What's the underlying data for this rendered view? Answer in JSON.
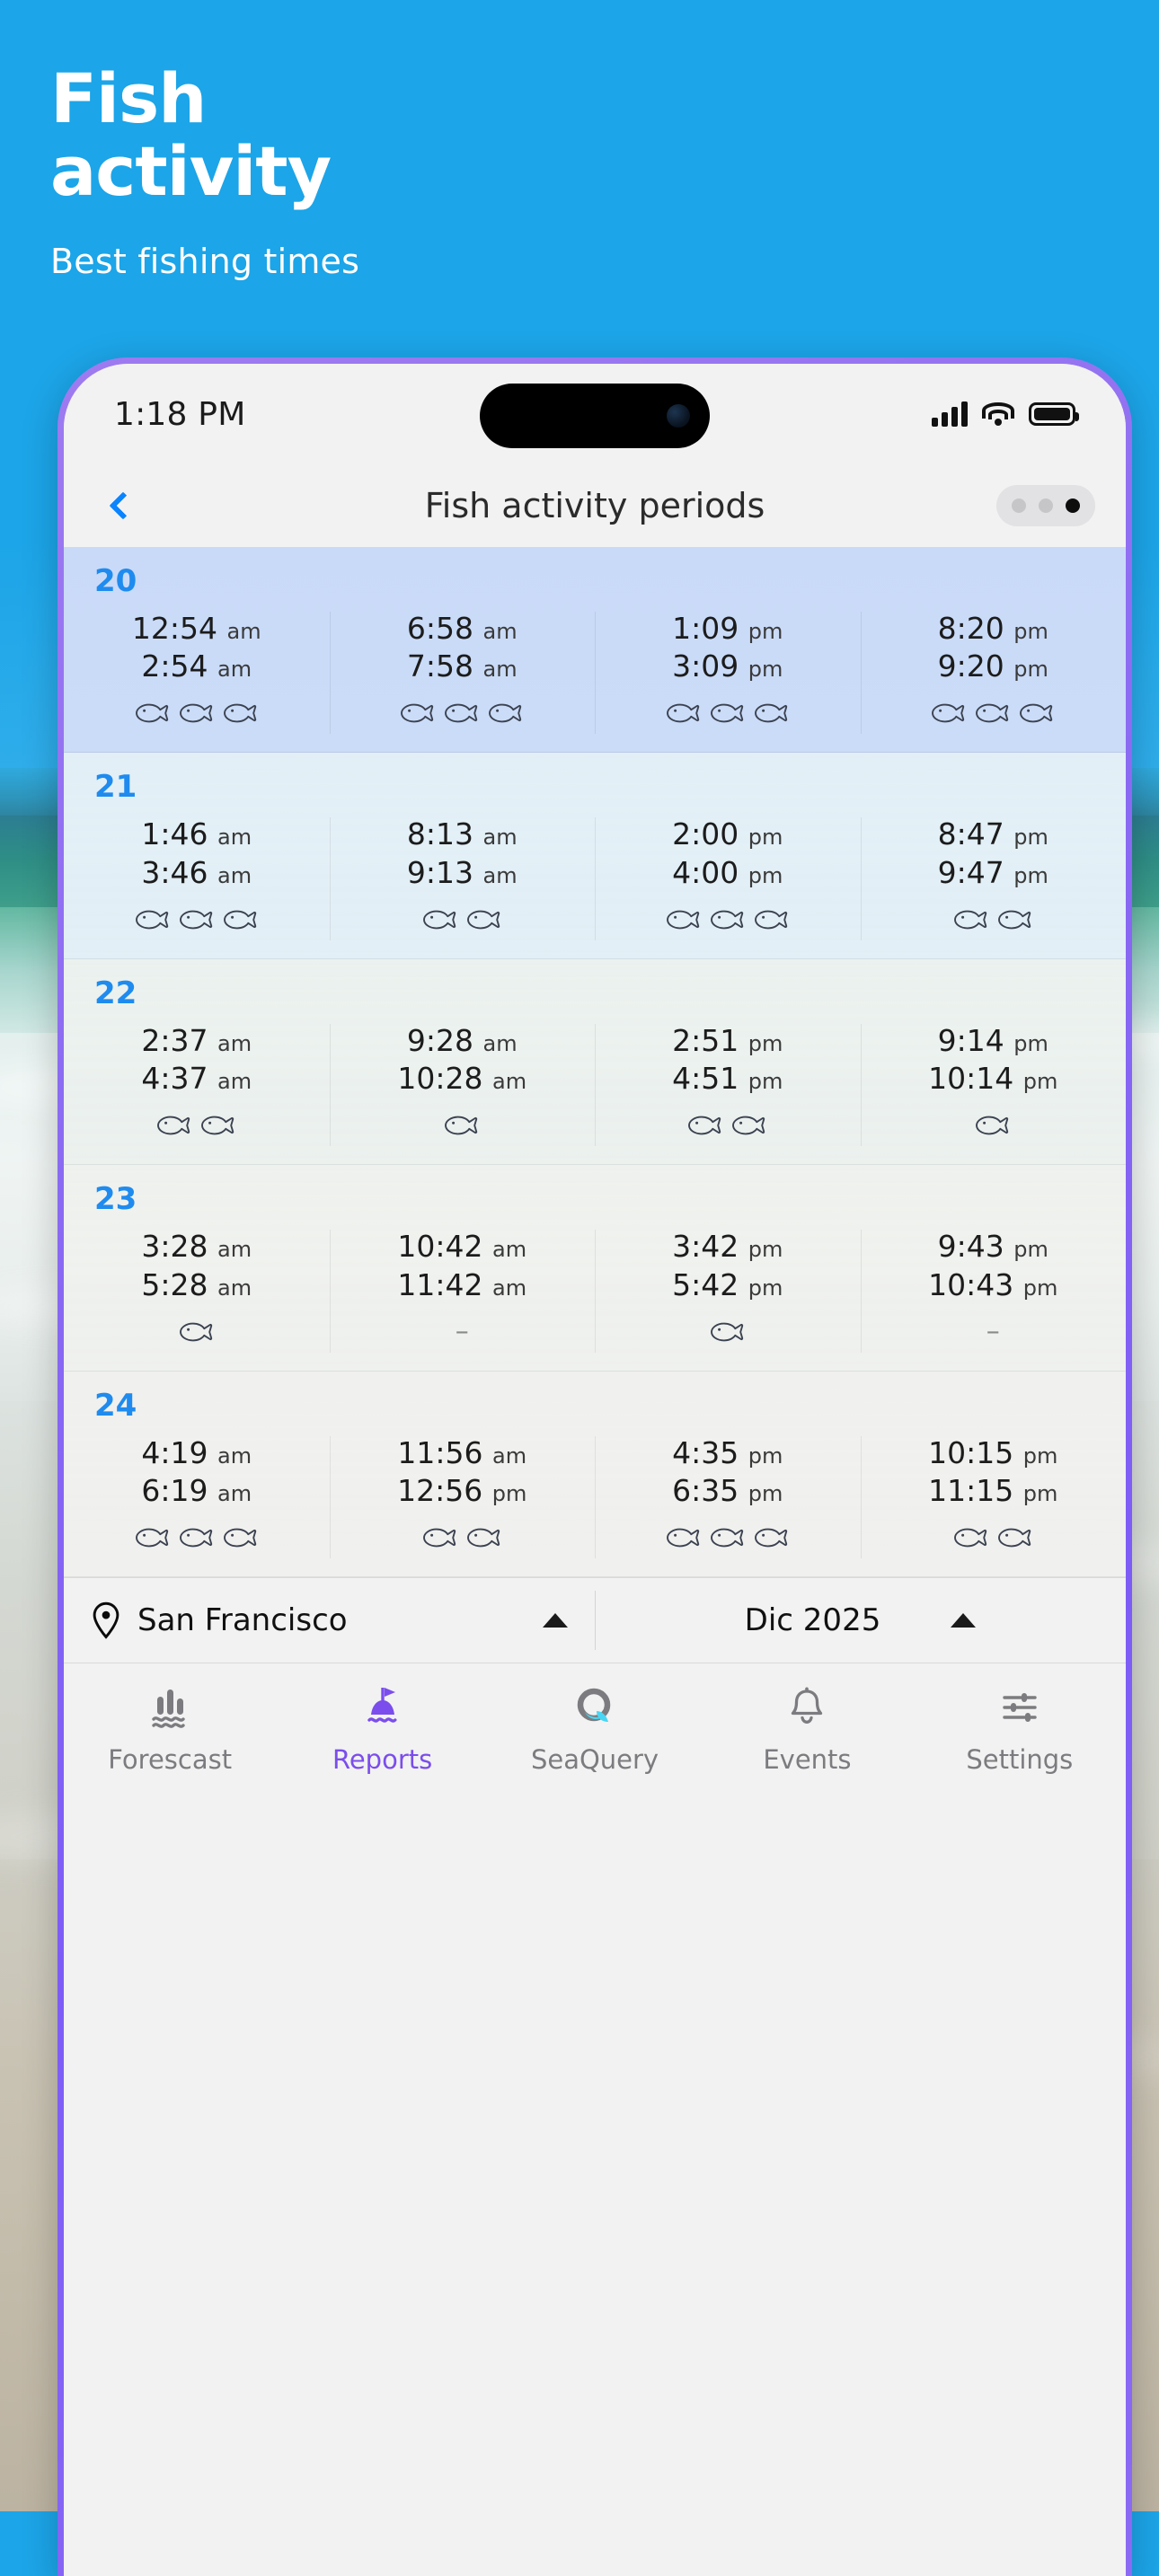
{
  "hero": {
    "title": "Fish\nactivity",
    "subtitle": "Best fishing times"
  },
  "colors": {
    "brand_blue": "#1CA5E8",
    "accent_purple": "#7B4DEC",
    "link_blue": "#0A84FF",
    "day_number_blue": "#1F8BEF"
  },
  "status_bar": {
    "time": "1:18 PM",
    "signal_icon": "cellular-signal-icon",
    "wifi_icon": "wifi-icon",
    "battery_icon": "battery-full-icon"
  },
  "nav": {
    "back_icon": "chevron-left-icon",
    "title": "Fish activity periods",
    "dots": [
      "inactive",
      "inactive",
      "active"
    ]
  },
  "days": [
    {
      "day": "20",
      "highlight": true,
      "periods": [
        {
          "start": "12:54",
          "start_mer": "am",
          "end": "2:54",
          "end_mer": "am",
          "fish": 3
        },
        {
          "start": "6:58",
          "start_mer": "am",
          "end": "7:58",
          "end_mer": "am",
          "fish": 3
        },
        {
          "start": "1:09",
          "start_mer": "pm",
          "end": "3:09",
          "end_mer": "pm",
          "fish": 3
        },
        {
          "start": "8:20",
          "start_mer": "pm",
          "end": "9:20",
          "end_mer": "pm",
          "fish": 3
        }
      ]
    },
    {
      "day": "21",
      "highlight": false,
      "periods": [
        {
          "start": "1:46",
          "start_mer": "am",
          "end": "3:46",
          "end_mer": "am",
          "fish": 3
        },
        {
          "start": "8:13",
          "start_mer": "am",
          "end": "9:13",
          "end_mer": "am",
          "fish": 2
        },
        {
          "start": "2:00",
          "start_mer": "pm",
          "end": "4:00",
          "end_mer": "pm",
          "fish": 3
        },
        {
          "start": "8:47",
          "start_mer": "pm",
          "end": "9:47",
          "end_mer": "pm",
          "fish": 2
        }
      ]
    },
    {
      "day": "22",
      "highlight": false,
      "periods": [
        {
          "start": "2:37",
          "start_mer": "am",
          "end": "4:37",
          "end_mer": "am",
          "fish": 2
        },
        {
          "start": "9:28",
          "start_mer": "am",
          "end": "10:28",
          "end_mer": "am",
          "fish": 1
        },
        {
          "start": "2:51",
          "start_mer": "pm",
          "end": "4:51",
          "end_mer": "pm",
          "fish": 2
        },
        {
          "start": "9:14",
          "start_mer": "pm",
          "end": "10:14",
          "end_mer": "pm",
          "fish": 1
        }
      ]
    },
    {
      "day": "23",
      "highlight": false,
      "periods": [
        {
          "start": "3:28",
          "start_mer": "am",
          "end": "5:28",
          "end_mer": "am",
          "fish": 1
        },
        {
          "start": "10:42",
          "start_mer": "am",
          "end": "11:42",
          "end_mer": "am",
          "fish": 0
        },
        {
          "start": "3:42",
          "start_mer": "pm",
          "end": "5:42",
          "end_mer": "pm",
          "fish": 1
        },
        {
          "start": "9:43",
          "start_mer": "pm",
          "end": "10:43",
          "end_mer": "pm",
          "fish": 0
        }
      ]
    },
    {
      "day": "24",
      "highlight": false,
      "periods": [
        {
          "start": "4:19",
          "start_mer": "am",
          "end": "6:19",
          "end_mer": "am",
          "fish": 3
        },
        {
          "start": "11:56",
          "start_mer": "am",
          "end": "12:56",
          "end_mer": "pm",
          "fish": 2
        },
        {
          "start": "4:35",
          "start_mer": "pm",
          "end": "6:35",
          "end_mer": "pm",
          "fish": 3
        },
        {
          "start": "10:15",
          "start_mer": "pm",
          "end": "11:15",
          "end_mer": "pm",
          "fish": 2
        }
      ]
    }
  ],
  "selectors": {
    "location_icon": "location-pin-icon",
    "location": "San Francisco",
    "month": "Dic 2025",
    "caret_icon": "caret-up-icon"
  },
  "tabbar": {
    "items": [
      {
        "label": "Forescast",
        "icon": "tide-chart-icon",
        "active": false
      },
      {
        "label": "Reports",
        "icon": "buoy-flag-icon",
        "active": true
      },
      {
        "label": "SeaQuery",
        "icon": "seaquery-q-icon",
        "active": false
      },
      {
        "label": "Events",
        "icon": "alarm-bell-icon",
        "active": false
      },
      {
        "label": "Settings",
        "icon": "sliders-icon",
        "active": false
      }
    ]
  },
  "empty_period_marker": "–"
}
